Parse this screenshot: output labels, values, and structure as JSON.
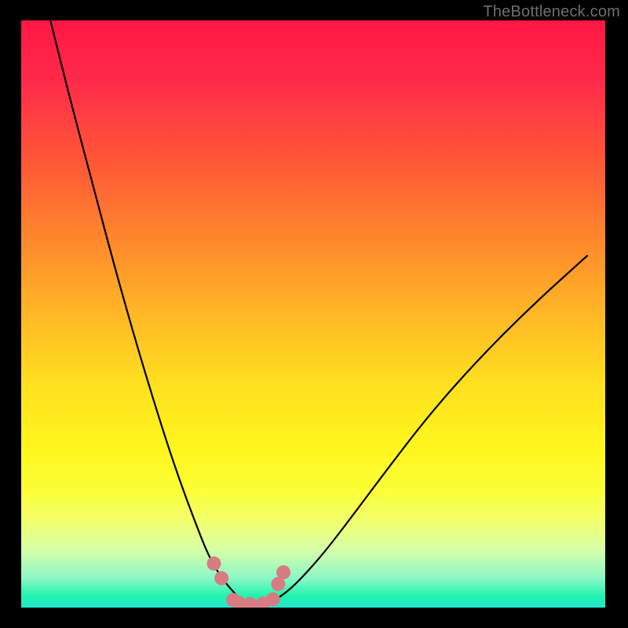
{
  "watermark": "TheBottleneck.com",
  "chart_data": {
    "type": "line",
    "title": "",
    "xlabel": "",
    "ylabel": "",
    "ylim": [
      0,
      100
    ],
    "xlim": [
      0,
      100
    ],
    "series": [
      {
        "name": "curve-left",
        "x": [
          5,
          8,
          12,
          16,
          20,
          24,
          27,
          30,
          32,
          34,
          36,
          37.5,
          38.5
        ],
        "y": [
          100,
          88,
          73,
          58,
          44,
          31,
          22,
          14,
          9,
          5.5,
          3,
          1.5,
          0.7
        ]
      },
      {
        "name": "curve-right",
        "x": [
          42.5,
          45,
          48,
          52,
          57,
          63,
          70,
          78,
          87,
          97
        ],
        "y": [
          0.7,
          2.2,
          5,
          9.5,
          16,
          24,
          33,
          42,
          51,
          60
        ]
      }
    ],
    "scatter": {
      "name": "highlight-points",
      "color": "#d97b82",
      "x": [
        33.0,
        34.3,
        36.3,
        37.3,
        39.2,
        41.4,
        43.1,
        44.0,
        44.9
      ],
      "y": [
        7.5,
        5.0,
        1.3,
        0.8,
        0.6,
        0.7,
        1.4,
        4.0,
        6.0
      ]
    }
  }
}
